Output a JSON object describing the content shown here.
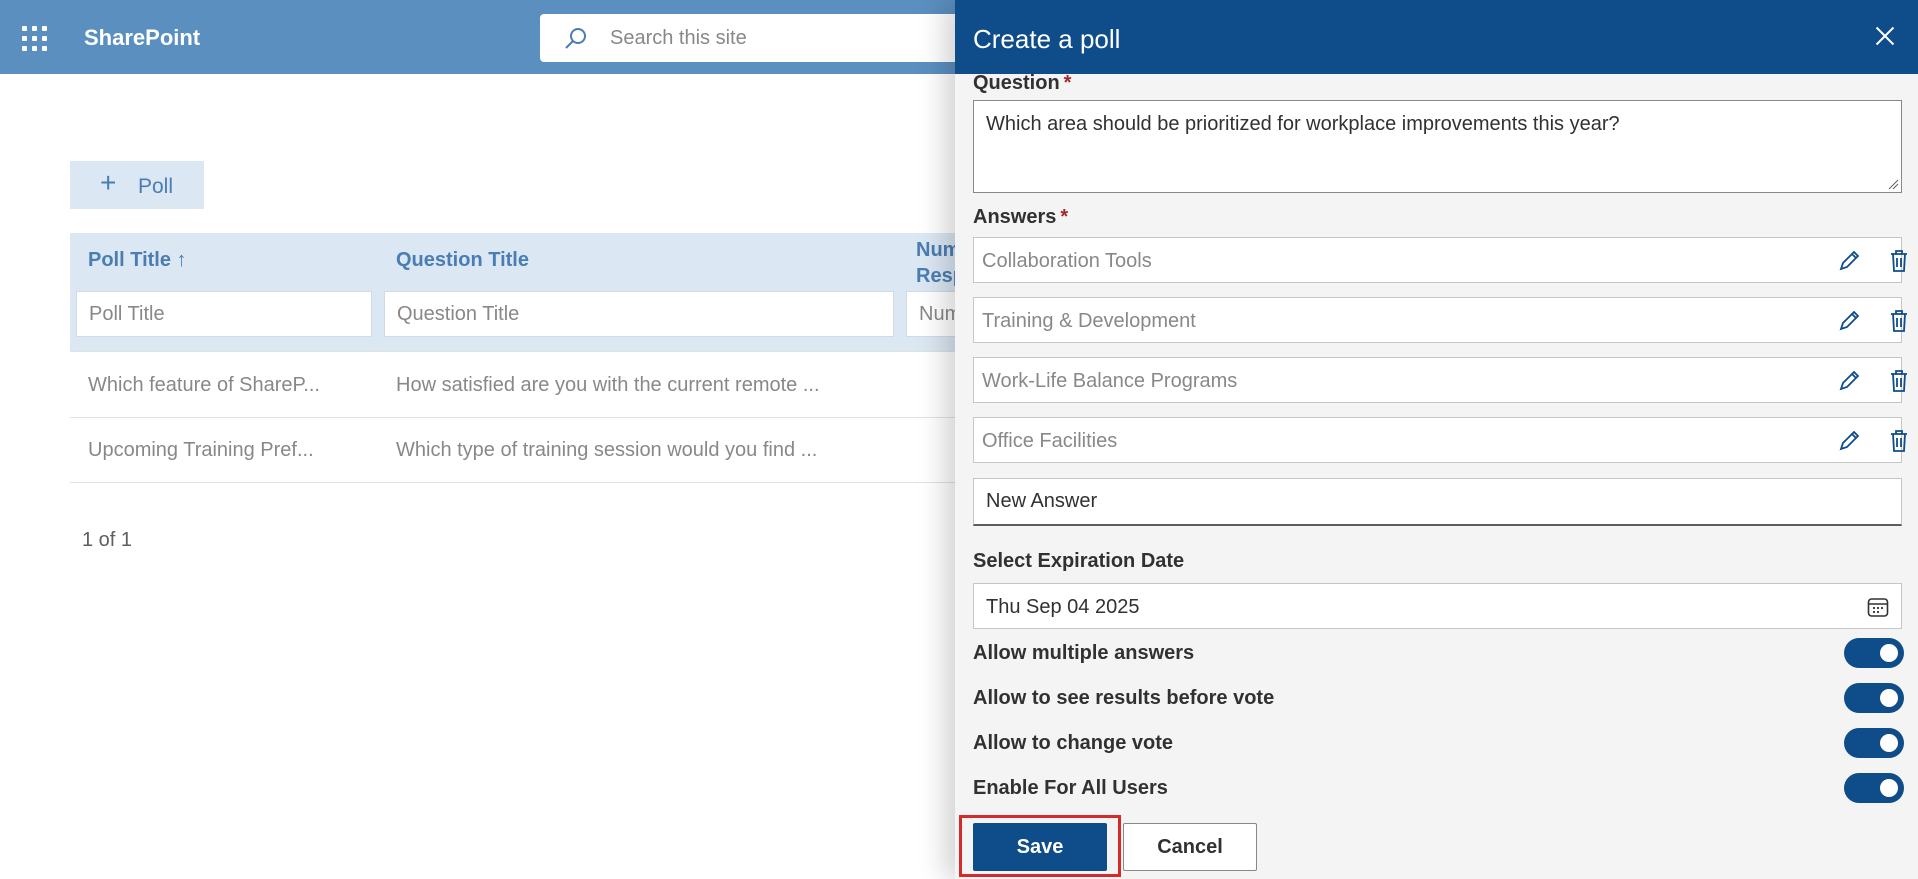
{
  "suitebar": {
    "app_name": "SharePoint",
    "search_placeholder": "Search this site",
    "bg_color": "#5b8fbf"
  },
  "page": {
    "add_poll_label": "Poll",
    "columns": [
      "Poll Title ↑",
      "Question Title",
      "Num Resp"
    ],
    "filters": [
      "Poll Title",
      "Question Title",
      "Num"
    ],
    "rows": [
      [
        "Which feature of ShareP...",
        "How satisfied are you with the current remote ..."
      ],
      [
        "Upcoming Training Pref...",
        "Which type of training session would you find ..."
      ]
    ],
    "pager": "1 of 1"
  },
  "panel": {
    "title": "Create a poll",
    "accent_color": "#0f4c8a",
    "question_label": "Question",
    "required_mark": "*",
    "question_value": "Which area should be prioritized for workplace improvements this year?",
    "answers_label": "Answers",
    "answers": [
      "Collaboration Tools",
      "Training & Development",
      "Work-Life Balance Programs",
      "Office Facilities"
    ],
    "new_answer_placeholder": "New Answer",
    "expiration_label": "Select Expiration Date",
    "expiration_value": "Thu Sep 04 2025",
    "toggles": [
      {
        "label": "Allow multiple answers",
        "on": true
      },
      {
        "label": "Allow to see results before vote",
        "on": true
      },
      {
        "label": "Allow to change vote",
        "on": true
      },
      {
        "label": "Enable For All Users",
        "on": true
      }
    ],
    "save_label": "Save",
    "cancel_label": "Cancel"
  }
}
